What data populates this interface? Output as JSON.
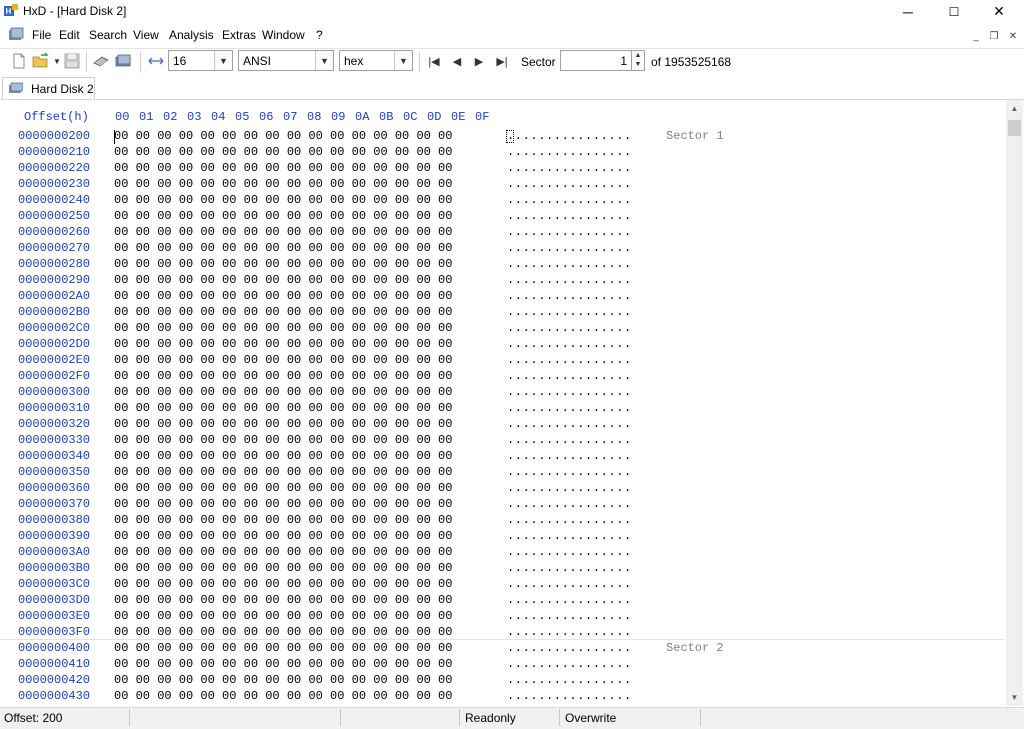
{
  "window": {
    "title": "HxD - [Hard Disk 2]",
    "controls": {
      "minimize": "─",
      "maximize": "☐",
      "close": "✕"
    }
  },
  "menu": {
    "items": [
      "File",
      "Edit",
      "Search",
      "View",
      "Analysis",
      "Extras",
      "Window",
      "?"
    ],
    "mdi": {
      "minimize": "_",
      "restore": "❐",
      "close": "✕"
    }
  },
  "toolbar": {
    "bytes_per_row": "16",
    "charset": "ANSI",
    "offset_base": "hex",
    "sector_label": "Sector",
    "sector_value": "1",
    "sector_total_label": "of 1953525168"
  },
  "tab": {
    "label": "Hard Disk 2"
  },
  "editor": {
    "header_offset": "Offset(h)",
    "header_columns": [
      "00",
      "01",
      "02",
      "03",
      "04",
      "05",
      "06",
      "07",
      "08",
      "09",
      "0A",
      "0B",
      "0C",
      "0D",
      "0E",
      "0F"
    ],
    "row_bytes": "00 00 00 00 00 00 00 00 00 00 00 00 00 00 00 00",
    "row_text": "................",
    "rows": [
      {
        "offset": "0000000200",
        "sector": "Sector 1"
      },
      {
        "offset": "0000000210",
        "sector": ""
      },
      {
        "offset": "0000000220",
        "sector": ""
      },
      {
        "offset": "0000000230",
        "sector": ""
      },
      {
        "offset": "0000000240",
        "sector": ""
      },
      {
        "offset": "0000000250",
        "sector": ""
      },
      {
        "offset": "0000000260",
        "sector": ""
      },
      {
        "offset": "0000000270",
        "sector": ""
      },
      {
        "offset": "0000000280",
        "sector": ""
      },
      {
        "offset": "0000000290",
        "sector": ""
      },
      {
        "offset": "00000002A0",
        "sector": ""
      },
      {
        "offset": "00000002B0",
        "sector": ""
      },
      {
        "offset": "00000002C0",
        "sector": ""
      },
      {
        "offset": "00000002D0",
        "sector": ""
      },
      {
        "offset": "00000002E0",
        "sector": ""
      },
      {
        "offset": "00000002F0",
        "sector": ""
      },
      {
        "offset": "0000000300",
        "sector": ""
      },
      {
        "offset": "0000000310",
        "sector": ""
      },
      {
        "offset": "0000000320",
        "sector": ""
      },
      {
        "offset": "0000000330",
        "sector": ""
      },
      {
        "offset": "0000000340",
        "sector": ""
      },
      {
        "offset": "0000000350",
        "sector": ""
      },
      {
        "offset": "0000000360",
        "sector": ""
      },
      {
        "offset": "0000000370",
        "sector": ""
      },
      {
        "offset": "0000000380",
        "sector": ""
      },
      {
        "offset": "0000000390",
        "sector": ""
      },
      {
        "offset": "00000003A0",
        "sector": ""
      },
      {
        "offset": "00000003B0",
        "sector": ""
      },
      {
        "offset": "00000003C0",
        "sector": ""
      },
      {
        "offset": "00000003D0",
        "sector": ""
      },
      {
        "offset": "00000003E0",
        "sector": ""
      },
      {
        "offset": "00000003F0",
        "sector": ""
      },
      {
        "offset": "0000000400",
        "sector": "Sector 2"
      },
      {
        "offset": "0000000410",
        "sector": ""
      },
      {
        "offset": "0000000420",
        "sector": ""
      },
      {
        "offset": "0000000430",
        "sector": ""
      }
    ]
  },
  "status": {
    "offset": "Offset: 200",
    "mode": "Readonly",
    "input_mode": "Overwrite"
  },
  "icons": {
    "app": "hxd-app-icon",
    "new": "new-file-icon",
    "open": "open-folder-icon",
    "save": "save-icon",
    "open_disk": "open-disk-icon",
    "open_ram": "open-ram-icon",
    "bytes_per_row": "bytes-per-row-icon"
  }
}
